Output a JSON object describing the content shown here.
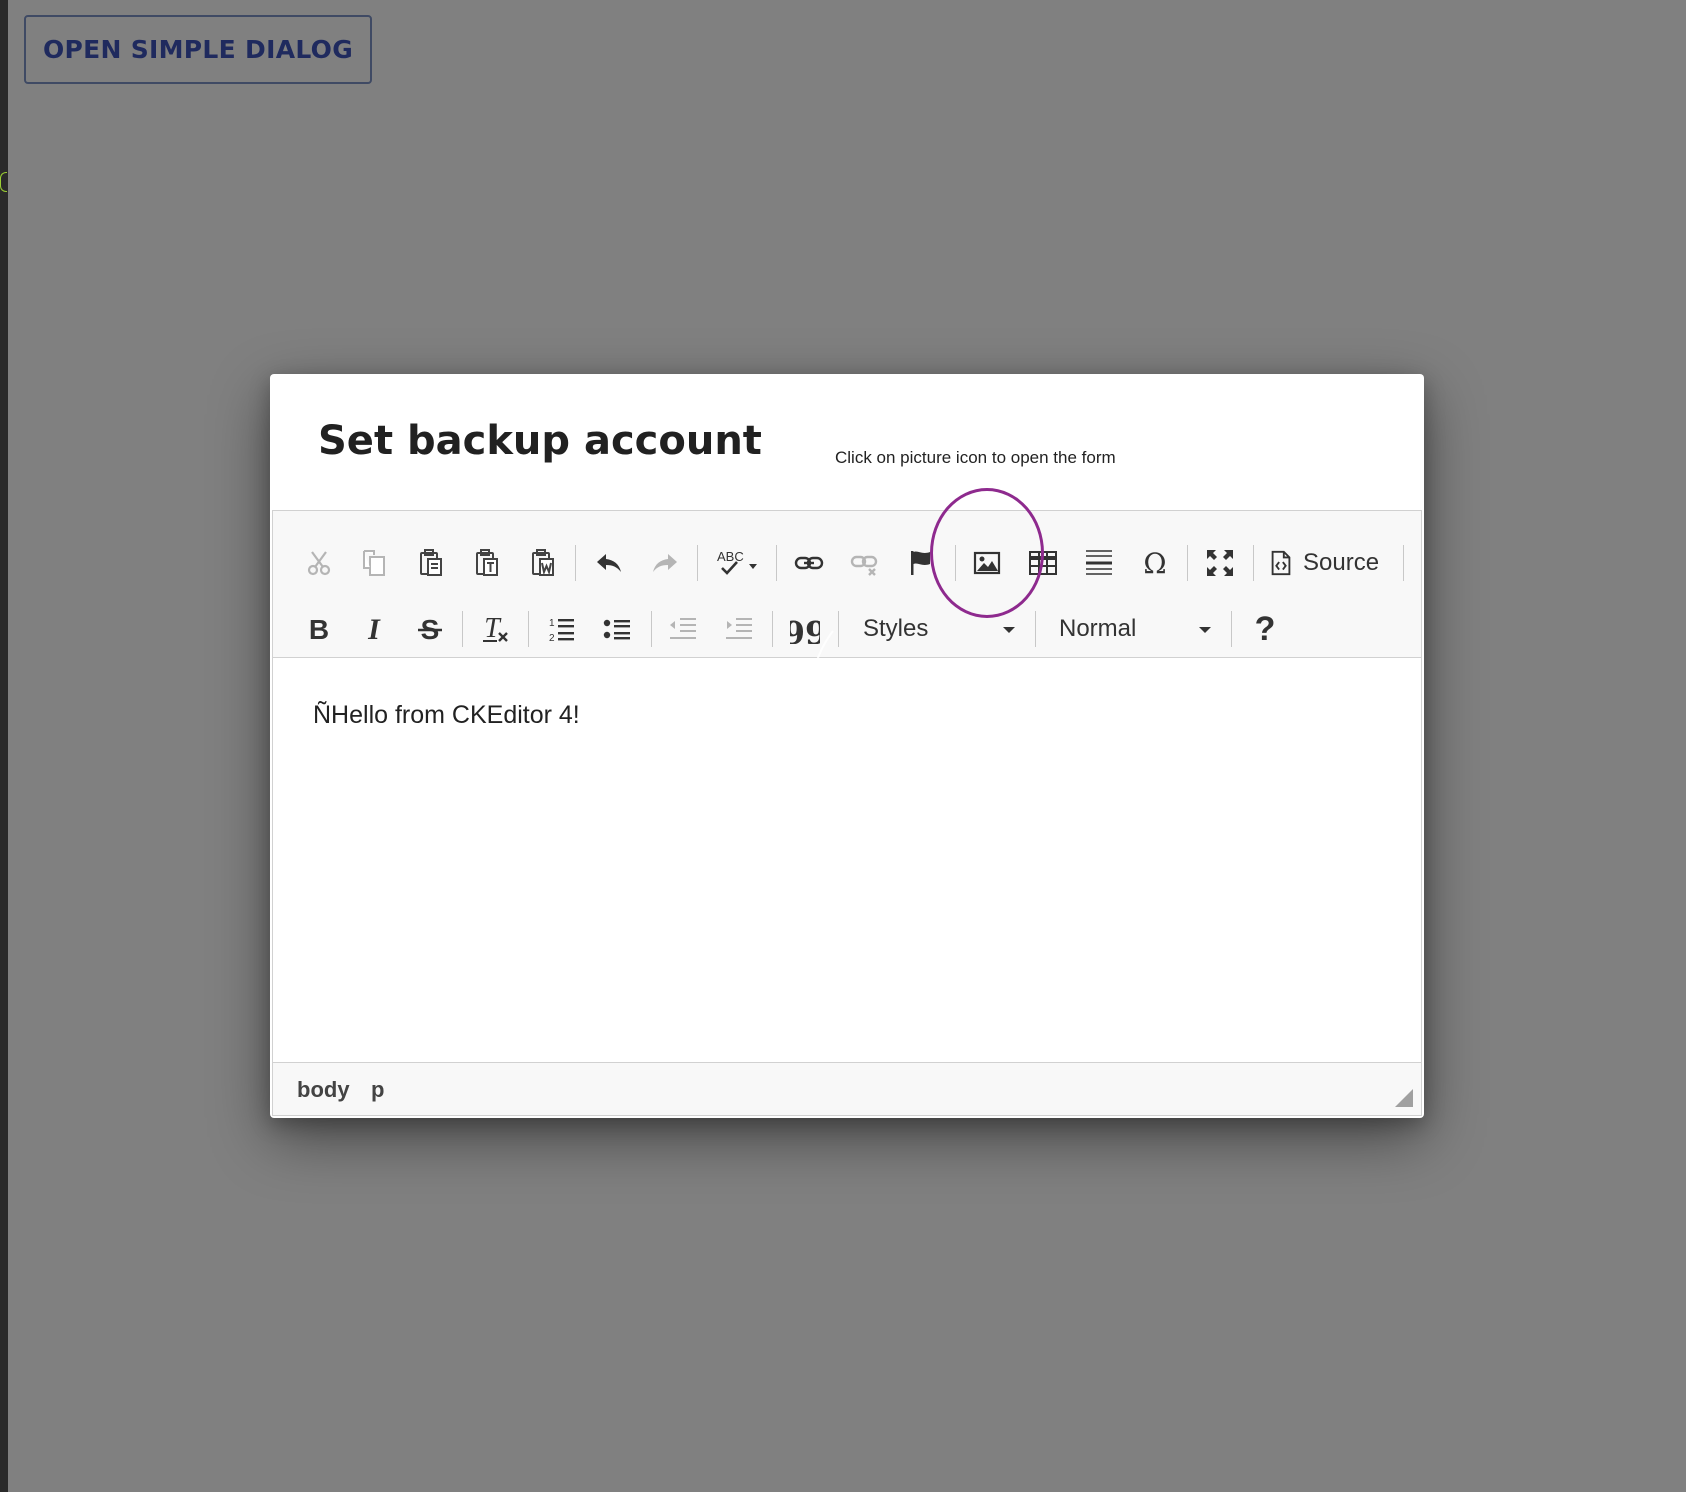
{
  "page": {
    "open_button_label": "OPEN SIMPLE DIALOG"
  },
  "dialog": {
    "title": "Set backup account",
    "hint": "Click on picture icon to open the form"
  },
  "toolbar": {
    "row1": [
      {
        "name": "cut-icon",
        "enabled": false
      },
      {
        "name": "copy-icon",
        "enabled": false
      },
      {
        "name": "paste-icon",
        "enabled": true
      },
      {
        "name": "paste-text-icon",
        "enabled": true
      },
      {
        "name": "paste-word-icon",
        "enabled": true
      },
      {
        "name": "undo-icon",
        "enabled": true
      },
      {
        "name": "redo-icon",
        "enabled": false
      },
      {
        "name": "spellcheck-icon",
        "enabled": true
      },
      {
        "name": "link-icon",
        "enabled": true
      },
      {
        "name": "unlink-icon",
        "enabled": false
      },
      {
        "name": "anchor-icon",
        "enabled": true
      },
      {
        "name": "image-icon",
        "enabled": true
      },
      {
        "name": "table-icon",
        "enabled": true
      },
      {
        "name": "horizontal-line-icon",
        "enabled": true
      },
      {
        "name": "special-char-icon",
        "enabled": true
      },
      {
        "name": "maximize-icon",
        "enabled": true
      }
    ],
    "source_label": "Source",
    "styles_label": "Styles",
    "format_label": "Normal",
    "help_label": "?"
  },
  "editor": {
    "content": "ÑHello from CKEditor 4!"
  },
  "statusbar": {
    "path": [
      "body",
      "p"
    ]
  },
  "colors": {
    "highlight": "#8e2a8e",
    "button_text": "#1f2a5e",
    "overlay": "#808080"
  }
}
